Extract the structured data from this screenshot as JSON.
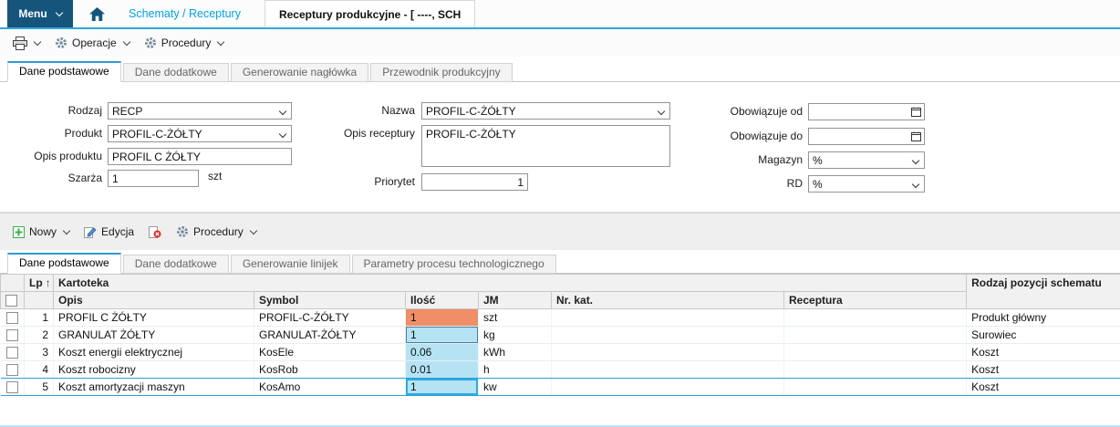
{
  "topbar": {
    "menu_label": "Menu",
    "module_tab": "Schematy / Receptury",
    "document_tab": "Receptury produkcyjne - [ ----, SCH"
  },
  "main_toolbar": {
    "operacje_label": "Operacje",
    "procedury_label": "Procedury"
  },
  "header_tabs": [
    "Dane podstawowe",
    "Dane dodatkowe",
    "Generowanie nagłówka",
    "Przewodnik produkcyjny"
  ],
  "form": {
    "rodzaj": {
      "label": "Rodzaj",
      "value": "RECP"
    },
    "produkt": {
      "label": "Produkt",
      "value": "PROFIL-C-ŻÓŁTY"
    },
    "opis_produktu": {
      "label": "Opis produktu",
      "value": "PROFIL C ŻÓŁTY"
    },
    "szarza": {
      "label": "Szarża",
      "value": "1",
      "unit": "szt"
    },
    "nazwa": {
      "label": "Nazwa",
      "value": "PROFIL-C-ŻÓŁTY"
    },
    "opis_receptury": {
      "label": "Opis receptury",
      "value": "PROFIL-C-ŻÓŁTY"
    },
    "priorytet": {
      "label": "Priorytet",
      "value": "1"
    },
    "obowiazuje_od": {
      "label": "Obowiązuje od",
      "value": ""
    },
    "obowiazuje_do": {
      "label": "Obowiązuje do",
      "value": ""
    },
    "magazyn": {
      "label": "Magazyn",
      "value": "%"
    },
    "rd": {
      "label": "RD",
      "value": "%"
    }
  },
  "grid_toolbar": {
    "nowy_label": "Nowy",
    "edycja_label": "Edycja",
    "procedury_label": "Procedury"
  },
  "grid_tabs": [
    "Dane podstawowe",
    "Dane dodatkowe",
    "Generowanie linijek",
    "Parametry procesu technologicznego"
  ],
  "table": {
    "headers": {
      "lp": "Lp",
      "sort_arrow": "↑",
      "kartoteka": "Kartoteka",
      "rodzaj": "Rodzaj pozycji schematu",
      "opis": "Opis",
      "symbol": "Symbol",
      "ilosc": "Ilość",
      "jm": "JM",
      "nr_kat": "Nr. kat.",
      "receptura": "Receptura"
    },
    "rows": [
      {
        "lp": "1",
        "opis": "PROFIL C ŻÓŁTY",
        "symbol": "PROFIL-C-ŻÓŁTY",
        "ilosc": "1",
        "jm": "szt",
        "nr_kat": "",
        "receptura": "",
        "rodzaj": "Produkt główny"
      },
      {
        "lp": "2",
        "opis": "GRANULAT ŻÓŁTY",
        "symbol": "GRANULAT-ŻÓŁTY",
        "ilosc": "1",
        "jm": "kg",
        "nr_kat": "",
        "receptura": "",
        "rodzaj": "Surowiec"
      },
      {
        "lp": "3",
        "opis": "Koszt energii elektrycznej",
        "symbol": "KosEle",
        "ilosc": "0.06",
        "jm": "kWh",
        "nr_kat": "",
        "receptura": "",
        "rodzaj": "Koszt"
      },
      {
        "lp": "4",
        "opis": "Koszt robocizny",
        "symbol": "KosRob",
        "ilosc": "0.01",
        "jm": "h",
        "nr_kat": "",
        "receptura": "",
        "rodzaj": "Koszt"
      },
      {
        "lp": "5",
        "opis": "Koszt amortyzacji maszyn",
        "symbol": "KosAmo",
        "ilosc": "1",
        "jm": "kw",
        "nr_kat": "",
        "receptura": "",
        "rodzaj": "Koszt"
      }
    ]
  },
  "colors": {
    "navy": "#15557c",
    "cyan_accent": "#2fa8de",
    "link_cyan": "#00a3e0",
    "salmon_cell": "#ef8e67",
    "cyan_cell": "#b5e3f4",
    "focus_border": "#29abe2",
    "selection_border": "#2e9fd8"
  }
}
